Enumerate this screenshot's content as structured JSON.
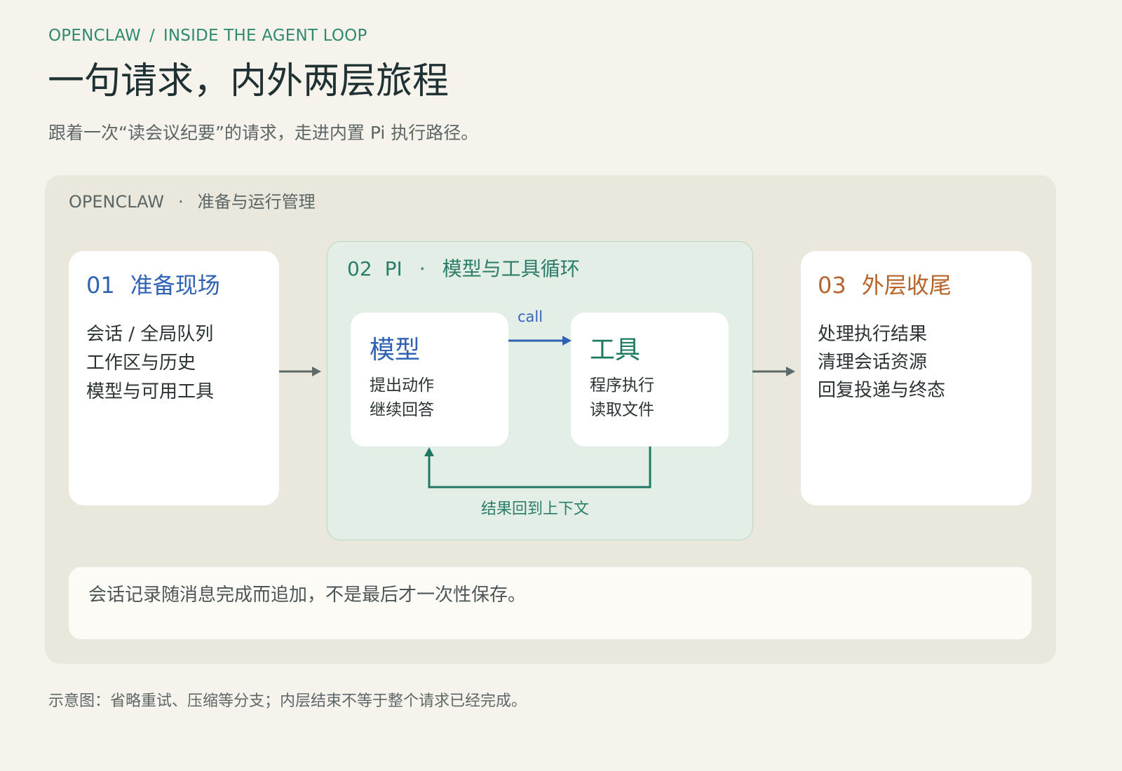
{
  "header": {
    "breadcrumb_root": "OPENCLAW",
    "breadcrumb_sep": "/",
    "breadcrumb_current": "INSIDE THE AGENT LOOP",
    "title": "一句请求，内外两层旅程",
    "subtitle": "跟着一次“读会议纪要”的请求，走进内置 Pi 执行路径。"
  },
  "outer": {
    "name": "OPENCLAW",
    "dot": "·",
    "desc": "准备与运行管理"
  },
  "stage01": {
    "num": "01",
    "title": "准备现场",
    "lines": [
      "会话 / 全局队列",
      "工作区与历史",
      "模型与可用工具"
    ]
  },
  "pi": {
    "num": "02",
    "name": "PI",
    "dot": "·",
    "desc": "模型与工具循环",
    "model": {
      "title": "模型",
      "lines": [
        "提出动作",
        "继续回答"
      ]
    },
    "tool": {
      "title": "工具",
      "lines": [
        "程序执行",
        "读取文件"
      ]
    },
    "call_label": "call",
    "loop_label": "结果回到上下文"
  },
  "stage03": {
    "num": "03",
    "title": "外层收尾",
    "lines": [
      "处理执行结果",
      "清理会话资源",
      "回复投递与终态"
    ]
  },
  "note": "会话记录随消息完成而追加，不是最后才一次性保存。",
  "footnote": "示意图：省略重试、压缩等分支；内层结束不等于整个请求已经完成。",
  "colors": {
    "blue": "#2f62b3",
    "teal": "#1f7a63",
    "orange": "#b5642c",
    "arrow_gray": "#5e6a6a"
  }
}
